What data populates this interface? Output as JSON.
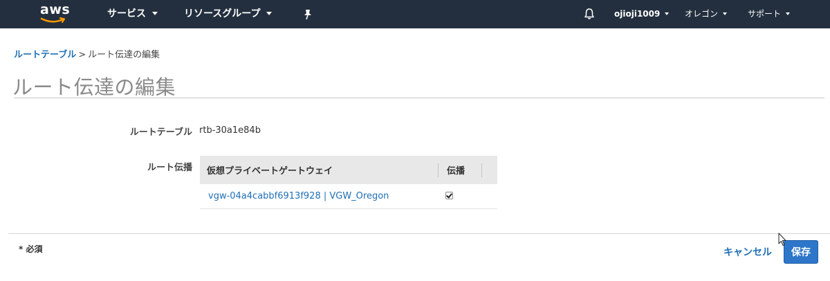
{
  "nav": {
    "logo_text": "aws",
    "services": "サービス",
    "resource_groups": "リソースグループ",
    "account": "ojioji1009",
    "region": "オレゴン",
    "support": "サポート",
    "icons": [
      "pin-icon",
      "bell-icon"
    ]
  },
  "breadcrumb": {
    "parent": "ルートテーブル",
    "separator": ">",
    "current": "ルート伝達の編集"
  },
  "page": {
    "title": "ルート伝達の編集"
  },
  "form": {
    "route_table_label": "ルートテーブル",
    "route_table_value": "rtb-30a1e84b",
    "route_propagation_label": "ルート伝播",
    "table": {
      "headers": [
        "仮想プライベートゲートウェイ",
        "伝播"
      ],
      "rows": [
        {
          "gateway": "vgw-04a4cabbf6913f928 | VGW_Oregon",
          "propagate": true
        }
      ]
    }
  },
  "footer": {
    "required_note": "* 必須",
    "cancel": "キャンセル",
    "save": "保存"
  },
  "colors": {
    "nav_bg": "#232f3e",
    "link": "#1f6fb5",
    "primary_button": "#2d76c9",
    "logo_smile": "#ff9900"
  }
}
